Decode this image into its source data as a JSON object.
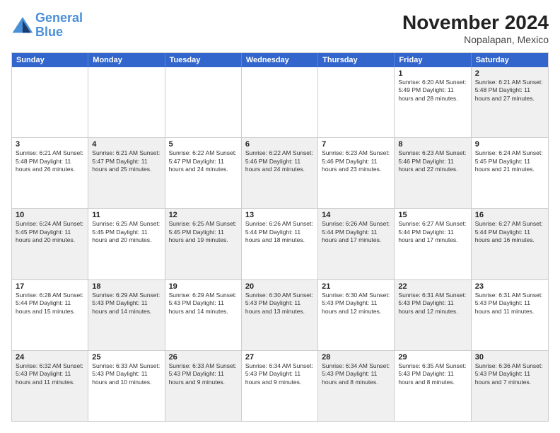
{
  "logo": {
    "line1": "General",
    "line2": "Blue"
  },
  "title": "November 2024",
  "subtitle": "Nopalapan, Mexico",
  "weekdays": [
    "Sunday",
    "Monday",
    "Tuesday",
    "Wednesday",
    "Thursday",
    "Friday",
    "Saturday"
  ],
  "weeks": [
    [
      {
        "day": "",
        "info": "",
        "shaded": false,
        "empty": true
      },
      {
        "day": "",
        "info": "",
        "shaded": false,
        "empty": true
      },
      {
        "day": "",
        "info": "",
        "shaded": false,
        "empty": true
      },
      {
        "day": "",
        "info": "",
        "shaded": false,
        "empty": true
      },
      {
        "day": "",
        "info": "",
        "shaded": false,
        "empty": true
      },
      {
        "day": "1",
        "info": "Sunrise: 6:20 AM\nSunset: 5:49 PM\nDaylight: 11 hours\nand 28 minutes.",
        "shaded": false
      },
      {
        "day": "2",
        "info": "Sunrise: 6:21 AM\nSunset: 5:48 PM\nDaylight: 11 hours\nand 27 minutes.",
        "shaded": true
      }
    ],
    [
      {
        "day": "3",
        "info": "Sunrise: 6:21 AM\nSunset: 5:48 PM\nDaylight: 11 hours\nand 26 minutes.",
        "shaded": false
      },
      {
        "day": "4",
        "info": "Sunrise: 6:21 AM\nSunset: 5:47 PM\nDaylight: 11 hours\nand 25 minutes.",
        "shaded": true
      },
      {
        "day": "5",
        "info": "Sunrise: 6:22 AM\nSunset: 5:47 PM\nDaylight: 11 hours\nand 24 minutes.",
        "shaded": false
      },
      {
        "day": "6",
        "info": "Sunrise: 6:22 AM\nSunset: 5:46 PM\nDaylight: 11 hours\nand 24 minutes.",
        "shaded": true
      },
      {
        "day": "7",
        "info": "Sunrise: 6:23 AM\nSunset: 5:46 PM\nDaylight: 11 hours\nand 23 minutes.",
        "shaded": false
      },
      {
        "day": "8",
        "info": "Sunrise: 6:23 AM\nSunset: 5:46 PM\nDaylight: 11 hours\nand 22 minutes.",
        "shaded": true
      },
      {
        "day": "9",
        "info": "Sunrise: 6:24 AM\nSunset: 5:45 PM\nDaylight: 11 hours\nand 21 minutes.",
        "shaded": false
      }
    ],
    [
      {
        "day": "10",
        "info": "Sunrise: 6:24 AM\nSunset: 5:45 PM\nDaylight: 11 hours\nand 20 minutes.",
        "shaded": true
      },
      {
        "day": "11",
        "info": "Sunrise: 6:25 AM\nSunset: 5:45 PM\nDaylight: 11 hours\nand 20 minutes.",
        "shaded": false
      },
      {
        "day": "12",
        "info": "Sunrise: 6:25 AM\nSunset: 5:45 PM\nDaylight: 11 hours\nand 19 minutes.",
        "shaded": true
      },
      {
        "day": "13",
        "info": "Sunrise: 6:26 AM\nSunset: 5:44 PM\nDaylight: 11 hours\nand 18 minutes.",
        "shaded": false
      },
      {
        "day": "14",
        "info": "Sunrise: 6:26 AM\nSunset: 5:44 PM\nDaylight: 11 hours\nand 17 minutes.",
        "shaded": true
      },
      {
        "day": "15",
        "info": "Sunrise: 6:27 AM\nSunset: 5:44 PM\nDaylight: 11 hours\nand 17 minutes.",
        "shaded": false
      },
      {
        "day": "16",
        "info": "Sunrise: 6:27 AM\nSunset: 5:44 PM\nDaylight: 11 hours\nand 16 minutes.",
        "shaded": true
      }
    ],
    [
      {
        "day": "17",
        "info": "Sunrise: 6:28 AM\nSunset: 5:44 PM\nDaylight: 11 hours\nand 15 minutes.",
        "shaded": false
      },
      {
        "day": "18",
        "info": "Sunrise: 6:29 AM\nSunset: 5:43 PM\nDaylight: 11 hours\nand 14 minutes.",
        "shaded": true
      },
      {
        "day": "19",
        "info": "Sunrise: 6:29 AM\nSunset: 5:43 PM\nDaylight: 11 hours\nand 14 minutes.",
        "shaded": false
      },
      {
        "day": "20",
        "info": "Sunrise: 6:30 AM\nSunset: 5:43 PM\nDaylight: 11 hours\nand 13 minutes.",
        "shaded": true
      },
      {
        "day": "21",
        "info": "Sunrise: 6:30 AM\nSunset: 5:43 PM\nDaylight: 11 hours\nand 12 minutes.",
        "shaded": false
      },
      {
        "day": "22",
        "info": "Sunrise: 6:31 AM\nSunset: 5:43 PM\nDaylight: 11 hours\nand 12 minutes.",
        "shaded": true
      },
      {
        "day": "23",
        "info": "Sunrise: 6:31 AM\nSunset: 5:43 PM\nDaylight: 11 hours\nand 11 minutes.",
        "shaded": false
      }
    ],
    [
      {
        "day": "24",
        "info": "Sunrise: 6:32 AM\nSunset: 5:43 PM\nDaylight: 11 hours\nand 11 minutes.",
        "shaded": true
      },
      {
        "day": "25",
        "info": "Sunrise: 6:33 AM\nSunset: 5:43 PM\nDaylight: 11 hours\nand 10 minutes.",
        "shaded": false
      },
      {
        "day": "26",
        "info": "Sunrise: 6:33 AM\nSunset: 5:43 PM\nDaylight: 11 hours\nand 9 minutes.",
        "shaded": true
      },
      {
        "day": "27",
        "info": "Sunrise: 6:34 AM\nSunset: 5:43 PM\nDaylight: 11 hours\nand 9 minutes.",
        "shaded": false
      },
      {
        "day": "28",
        "info": "Sunrise: 6:34 AM\nSunset: 5:43 PM\nDaylight: 11 hours\nand 8 minutes.",
        "shaded": true
      },
      {
        "day": "29",
        "info": "Sunrise: 6:35 AM\nSunset: 5:43 PM\nDaylight: 11 hours\nand 8 minutes.",
        "shaded": false
      },
      {
        "day": "30",
        "info": "Sunrise: 6:36 AM\nSunset: 5:43 PM\nDaylight: 11 hours\nand 7 minutes.",
        "shaded": true
      }
    ]
  ]
}
